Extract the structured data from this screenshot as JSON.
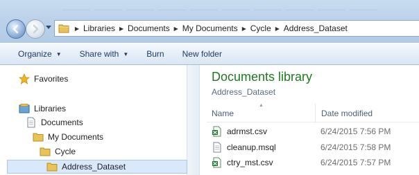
{
  "breadcrumbs": [
    "Libraries",
    "Documents",
    "My Documents",
    "Cycle",
    "Address_Dataset"
  ],
  "toolbar": {
    "organize": "Organize",
    "share_with": "Share with",
    "burn": "Burn",
    "new_folder": "New folder"
  },
  "nav_tree": {
    "favorites": "Favorites",
    "libraries": "Libraries",
    "documents": "Documents",
    "my_documents": "My Documents",
    "cycle": "Cycle",
    "address_dataset": "Address_Dataset"
  },
  "content": {
    "title": "Documents library",
    "subtitle": "Address_Dataset",
    "columns": {
      "name": "Name",
      "date_modified": "Date modified"
    },
    "files": [
      {
        "name": "adrmst.csv",
        "date": "6/24/2015 7:56 PM",
        "icon": "excel-csv-icon"
      },
      {
        "name": "cleanup.msql",
        "date": "6/24/2015 7:58 PM",
        "icon": "text-file-icon"
      },
      {
        "name": "ctry_mst.csv",
        "date": "6/24/2015 7:57 PM",
        "icon": "excel-csv-icon"
      }
    ]
  },
  "colors": {
    "library_title": "#1e7a1e",
    "toolbar_text": "#1e395b",
    "selection": "#d9e9fb"
  }
}
